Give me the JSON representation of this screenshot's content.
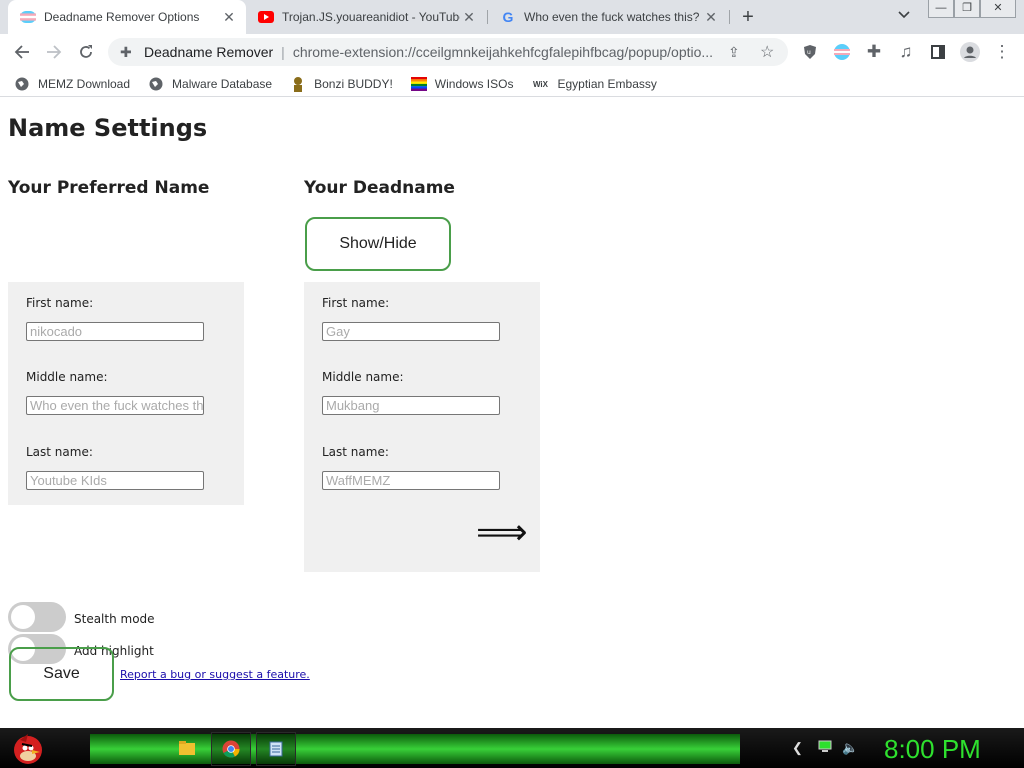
{
  "tabs": [
    {
      "title": "Deadname Remover Options",
      "favicon": "trans-flag-icon",
      "active": true
    },
    {
      "title": "Trojan.JS.youareanidiot - YouTube",
      "favicon": "youtube-icon",
      "active": false
    },
    {
      "title": "Who even the fuck watches this?",
      "favicon": "google-icon",
      "active": false
    }
  ],
  "toolbar": {
    "site_name": "Deadname Remover",
    "url": "chrome-extension://cceilgmnkeijahkehfcgfalepihfbcag/popup/optio..."
  },
  "bookmarks": [
    {
      "label": "MEMZ Download",
      "icon": "globe-icon"
    },
    {
      "label": "Malware Database",
      "icon": "globe-icon"
    },
    {
      "label": "Bonzi BUDDY!",
      "icon": "bonzi-icon"
    },
    {
      "label": "Windows ISOs",
      "icon": "windows-icon"
    },
    {
      "label": "Egyptian Embassy",
      "icon": "wix-icon"
    }
  ],
  "page": {
    "title": "Name Settings",
    "preferred": {
      "heading": "Your Preferred Name",
      "first_label": "First name:",
      "first_placeholder": "nikocado",
      "middle_label": "Middle name:",
      "middle_placeholder": "Who even the fuck watches this",
      "last_label": "Last name:",
      "last_placeholder": "Youtube KIds"
    },
    "deadname": {
      "heading": "Your Deadname",
      "toggle_button": "Show/Hide",
      "first_label": "First name:",
      "first_placeholder": "Gay",
      "middle_label": "Middle name:",
      "middle_placeholder": "Mukbang",
      "last_label": "Last name:",
      "last_placeholder": "WaffMEMZ",
      "arrow": "⟹"
    },
    "stealth_label": "Stealth mode",
    "highlight_label": "Add highlight",
    "save_label": "Save",
    "report_link": "Report a bug or suggest a feature."
  },
  "taskbar": {
    "clock": "8:00 PM"
  },
  "colors": {
    "accent_green": "#4a9e4a",
    "clock_green": "#2ee02e",
    "link": "#1a0dab"
  }
}
